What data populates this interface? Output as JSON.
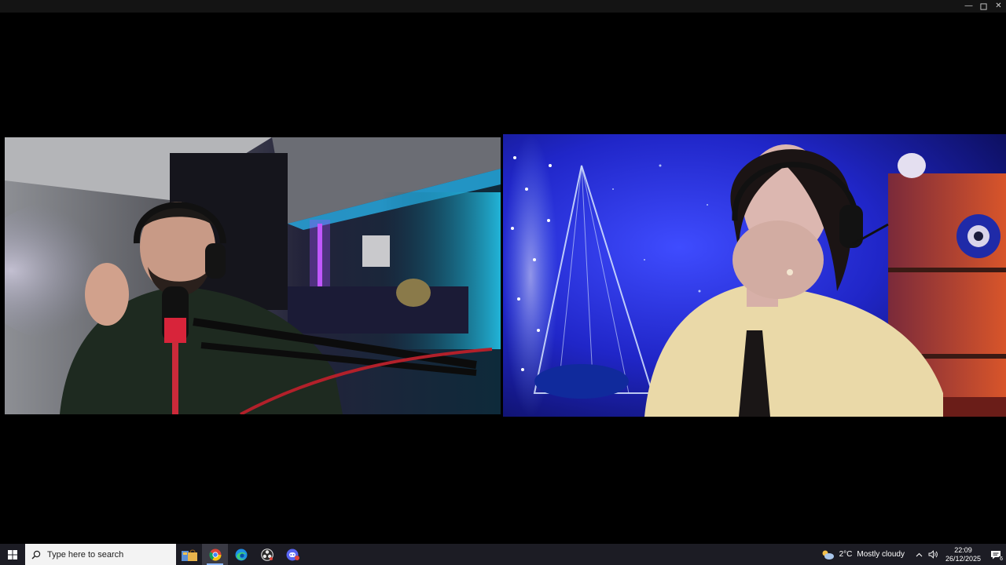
{
  "window": {
    "minimize_symbol": "—",
    "maximize_symbol": "☐",
    "close_symbol": "✕"
  },
  "video": {
    "left_participant": {
      "scene": "man-with-headphones-and-microphone",
      "accent": "#a24cff"
    },
    "right_participant": {
      "scene": "woman-with-headset-blue-room",
      "accent": "#2a3cff"
    }
  },
  "taskbar": {
    "search_placeholder": "Type here to search",
    "apps": [
      {
        "name": "news-widgets",
        "icon": "shopping-bags-icon"
      },
      {
        "name": "chrome",
        "icon": "chrome-icon",
        "active": true
      },
      {
        "name": "edge",
        "icon": "edge-icon"
      },
      {
        "name": "obs",
        "icon": "obs-icon"
      },
      {
        "name": "discord",
        "icon": "discord-icon"
      }
    ],
    "weather": {
      "temperature": "2°C",
      "condition": "Mostly cloudy"
    },
    "time": "22:09",
    "date": "26/12/2025",
    "notification_count": "6"
  }
}
